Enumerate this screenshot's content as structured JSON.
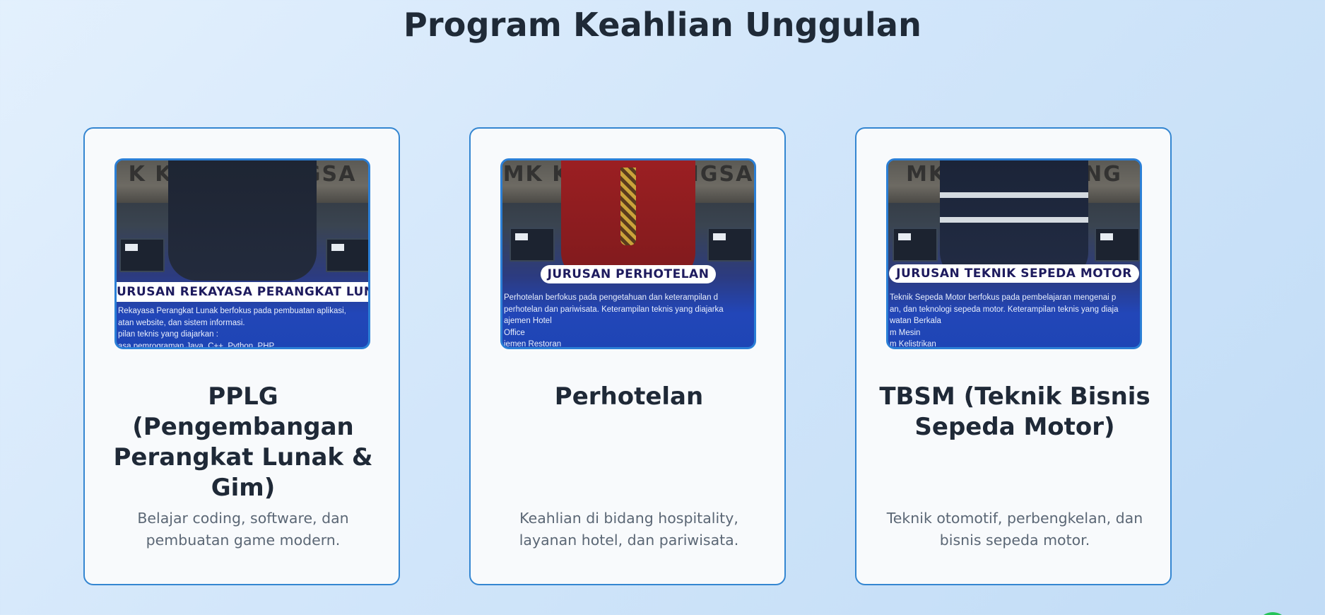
{
  "section": {
    "title": "Program Keahlian Unggulan"
  },
  "cards": [
    {
      "title": "PPLG (Pengembangan Perangkat Lunak & Gim)",
      "description": "Belajar coding, software, dan pembuatan game modern.",
      "image": {
        "wall_text": "K KARYA BANGSA",
        "banner": "URUSAN REKAYASA PERANGKAT LUNA",
        "caption": "Rekayasa Perangkat Lunak berfokus pada pembuatan aplikasi,\natan website, dan sistem informasi.\npilan teknis yang diajarkan :\nasa pemrograman Java, C++, Python, PHP"
      }
    },
    {
      "title": "Perhotelan",
      "description": "Keahlian di bidang hospitality, layanan hotel, dan pariwisata.",
      "image": {
        "wall_text": "MK KARYA BANGSA",
        "banner": "JURUSAN PERHOTELAN",
        "caption": "Perhotelan berfokus pada pengetahuan dan keterampilan d\nperhotelan dan pariwisata. Keterampilan teknis yang diajarka\najemen Hotel\nOffice\njemen Restoran"
      }
    },
    {
      "title": "TBSM (Teknik Bisnis Sepeda Motor)",
      "description": "Teknik otomotif, perbengkelan, dan bisnis sepeda motor.",
      "image": {
        "wall_text": "MK KARYA BANG",
        "banner": "JURUSAN TEKNIK SEPEDA MOTOR",
        "caption": "Teknik Sepeda Motor berfokus pada pembelajaran mengenai p\nan, dan teknologi sepeda motor. Keterampilan teknis yang diaja\nwatan Berkala\nm Mesin\nm Kelistrikan"
      }
    }
  ],
  "colors": {
    "card_border": "#3486d1",
    "banner_text": "#1e1b5e",
    "chat_bubble": "#25c45a"
  }
}
